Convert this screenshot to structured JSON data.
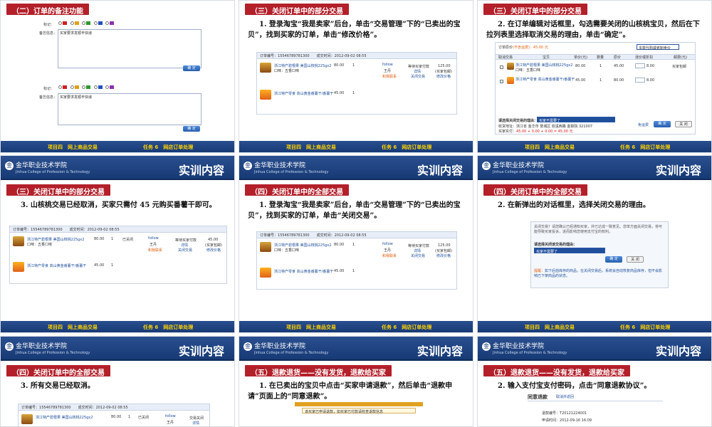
{
  "header": {
    "logo_name": "金华职业技术学院",
    "logo_en": "Jinhua College of Profession & Technology",
    "title": "实训内容"
  },
  "footer": {
    "project": "项目四　网上商品交易",
    "task": "任务 6　网店订单处理"
  },
  "colors": {
    "header_blue": "#1f4584",
    "section_red": "#b3202a",
    "footer_yellow": "#ffd200"
  },
  "slides": [
    {
      "section": "（二）订单的备注功能",
      "form": {
        "flag_label": "标记：",
        "note_label": "备忘信息：",
        "note_value": "买家要求发顺丰快递",
        "save": "确 定"
      }
    },
    {
      "section": "（三）关闭订单中的部分交易",
      "text": "1. 登录淘宝“我是卖家”后台，单击“交易管理”下的“已卖出的宝贝”，找到买家的订单，单击“修改价格”。"
    },
    {
      "section": "（三）关闭订单中的部分交易",
      "text": "2. 在订单编辑对话框里，勾选需要关闭的山核桃宝贝，然后在下拉列表里选择取消交易的理由，单击“确定”。",
      "dialog": {
        "title": "订单原价",
        "price_note": "(不含运费)：45.00 元",
        "reason_select": "多数代购或者制卖价",
        "cols": [
          "取消交易",
          "宝贝",
          "单价(元)",
          "数量",
          "原价",
          "涨价或折扣",
          "邮费(元)"
        ],
        "rows": [
          {
            "name": "浙江特产碧根果 美国山核桃225gx2",
            "sub": "口味：五香口味",
            "price": "80.00",
            "qty": "1",
            "total": "45.00",
            "disc": "8.00",
            "ship": "买家包邮"
          },
          {
            "name": "浙江特产零食 高山黄金番薯干/番薯干",
            "sub": "",
            "price": "45.00",
            "qty": "1",
            "total": "80.00",
            "disc": "8.00",
            "ship": ""
          }
        ],
        "reason_label": "请选择关闭交易的理由：",
        "reason_value": "买家不需要了",
        "addr_label": "收货地址：",
        "addr_value": "浙江省 金华市 婺城区 双溪西路 金职院 321007",
        "pay_label": "买家实付：",
        "pay_value": "45.00 + 0.00 + 0.00 = 45.00 元",
        "tip": "免运费",
        "ok": "确 定",
        "close": "关 闭"
      }
    },
    {
      "section": "（三）关闭订单中的部分交易",
      "text": "3. 山核桃交易已经取消，买家只需付 45 元购买番薯干即可。"
    },
    {
      "section": "（四）关闭订单中的全部交易",
      "text": "1. 登录淘宝“我是卖家”后台，单击“交易管理”下的“已卖出的宝贝”，找到买家的订单，单击“关闭交易”。"
    },
    {
      "section": "（四）关闭订单中的全部交易",
      "text": "2. 在新弹出的对话框里，选择关闭交易的理由。",
      "dialog": {
        "desc": "关闭交易？请您确认已经通知买家，并已达成一致意见。您单方面关闭交易，将可能导致买家投诉，进而影响您使用支付宝的权利。",
        "reason_label": "请选择关闭该交易的理由：",
        "reason_value": "买家不需要了",
        "ok": "确 定",
        "close": "关 闭",
        "hint_label": "提醒：",
        "hint": "如下后拍库存的商品，在关闭交易后，系统会自动恢复商品库存，但不会影响已下架商品的状态。"
      }
    },
    {
      "section": "（四）关闭订单中的全部交易",
      "text": "3. 所有交易已经取消。"
    },
    {
      "section": "（五）退款退货——没有发货，退款给买家",
      "text": "1. 在已卖出的宝贝中点击“买家申请退款”，然后单击“退款申请”页面上的“同意退款”。",
      "banner": "该买家已申请退款，如买家已付款请检查退款信息"
    },
    {
      "section": "（五）退款退货——没有发货，退款给买家",
      "text": "2. 输入支付宝支付密码，点击“同意退款协议”。",
      "refund": {
        "title": "同意退款",
        "back": "取消并返回",
        "no_label": "退款编号：",
        "no_value": "T20121224001",
        "time_label": "申请时间：",
        "time_value": "2012-09-16 16:09"
      }
    }
  ],
  "order": {
    "no_label": "订单编号：",
    "no_value": "15546789781300",
    "time_label": "成交时间：",
    "time_value": "2012-09-02 08:55",
    "item1": "浙江特产碧根果 美国山核桃225gx2",
    "item1_sub": "口味：五香口味",
    "item2": "浙江特产零食 高山黄金番薯干/番薯干",
    "price1": "80.00",
    "price2": "45.00",
    "qty": "1",
    "seller": "follow",
    "seller_name": "王丹",
    "contact": "和我联系",
    "status": "等待买家付款",
    "detail": "详情",
    "close": "关闭交易",
    "total": "125.00",
    "ship": "(买家包邮)",
    "edit": "修改价格",
    "total_after": "45.00",
    "closed": "已关闭",
    "all_closed": "交易关闭"
  }
}
